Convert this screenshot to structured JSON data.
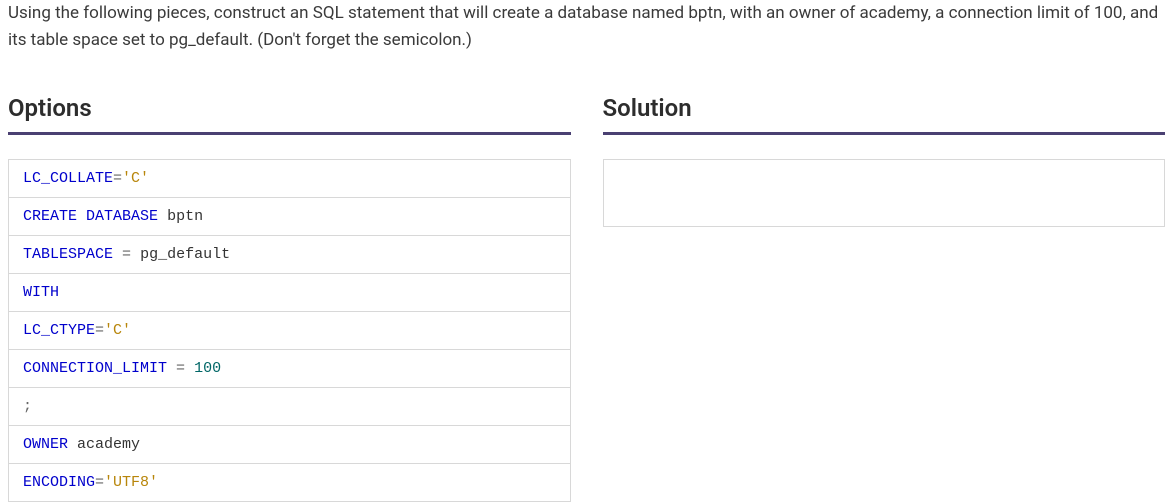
{
  "instruction": "Using the following pieces, construct an SQL statement that will create a database named bptn, with an owner of academy, a connection limit of 100, and its table space set to pg_default. (Don't forget the semicolon.)",
  "headers": {
    "options": "Options",
    "solution": "Solution"
  },
  "options": [
    "LC_COLLATE='C'",
    "CREATE DATABASE bptn",
    "TABLESPACE = pg_default",
    "WITH",
    "LC_CTYPE='C'",
    "CONNECTION_LIMIT = 100",
    ";",
    "OWNER academy",
    "ENCODING='UTF8'"
  ]
}
